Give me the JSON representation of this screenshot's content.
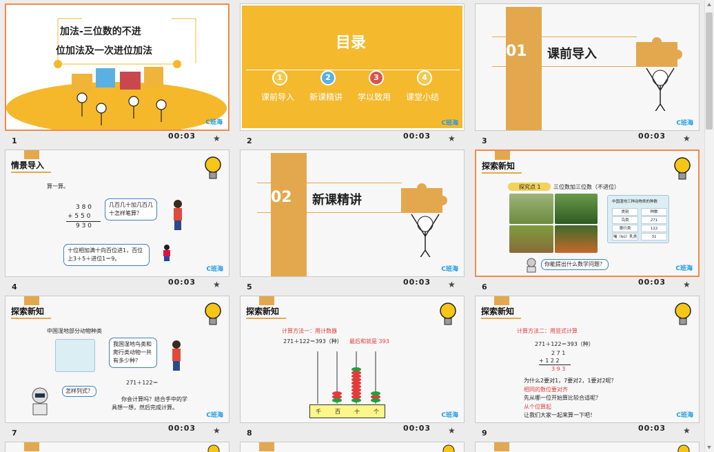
{
  "slides": [
    {
      "num": "1",
      "time": "00:03",
      "logo": "C班海",
      "title_line1": "加法-三位数的不进",
      "title_line2": "位加法及一次进位加法"
    },
    {
      "num": "2",
      "time": "00:03",
      "logo": "C班海",
      "title": "目录",
      "items": [
        {
          "n": "1",
          "label": "课前导入",
          "color": "#f2c94c"
        },
        {
          "n": "2",
          "label": "新课精讲",
          "color": "#5ab0e3"
        },
        {
          "n": "3",
          "label": "学以致用",
          "color": "#d9534f"
        },
        {
          "n": "4",
          "label": "课堂小结",
          "color": "#f2c94c"
        }
      ]
    },
    {
      "num": "3",
      "time": "00:03",
      "logo": "C班海",
      "sec_num": "01",
      "sec_title": "课前导入"
    },
    {
      "num": "4",
      "time": "00:03",
      "logo": "C班海",
      "header": "情景导入",
      "sub": "算一算。",
      "v1": "3 8 0",
      "v2": "+ 5 5 0",
      "v3": "9 3 0",
      "q1": "几百几十加几百几",
      "q2": "十怎样笔算？",
      "a1": "十位相加满十向百位进1，百位",
      "a2": "上3＋5＋进位1＝9。"
    },
    {
      "num": "5",
      "time": "00:03",
      "logo": "C班海",
      "sec_num": "02",
      "sec_title": "新课精讲"
    },
    {
      "num": "6",
      "time": "00:03",
      "logo": "C班海",
      "header": "探索新知",
      "tag": "探究点 1",
      "tag_text": "三位数加三位数（不进位）",
      "table_title": "中国湿地三种动物类的种数",
      "table_head": [
        "类别",
        "种数"
      ],
      "table_rows": [
        [
          "鸟类",
          "271"
        ],
        [
          "爬行类",
          "122"
        ],
        [
          "哺（bǔ）乳类",
          "31"
        ]
      ],
      "question": "你能提出什么数学问题？"
    },
    {
      "num": "7",
      "time": "00:03",
      "logo": "C班海",
      "header": "探索新知",
      "caption": "中国湿地部分动物种类",
      "b1": "我国湿地鸟类和",
      "b2": "爬行类动物一共",
      "b3": "有多少种？",
      "eq": "271＋122＝",
      "b4": "怎样列式？",
      "t1": "你会计算吗？结合手中的学",
      "t2": "具想一想，然后完成计算。"
    },
    {
      "num": "8",
      "time": "00:03",
      "logo": "C班海",
      "header": "探索新知",
      "m1": "计算方法一：用计数器",
      "eq": "271＋122＝393（种）",
      "r": "最后和就是 393",
      "abacus": [
        "千",
        "百",
        "十",
        "个"
      ]
    },
    {
      "num": "9",
      "time": "00:03",
      "logo": "C班海",
      "header": "探索新知",
      "m2": "计算方法二：用竖式计算",
      "eq": "271＋122＝393（种）",
      "c1": "2 7 1",
      "c2": "+   1 2 2",
      "c3": "3 9 3",
      "l1": "为什么2要对1，7要对2，1要对2呢？",
      "l2": "相同的数位要对齐",
      "l3": "先从哪一位开始算比较合适呢？",
      "l4": "从个位算起",
      "l5": "让我们大家一起来算一下吧！"
    }
  ],
  "colors": {
    "accent": "#f08a4b",
    "gold": "#e3a84d",
    "yellow": "#f5b92e",
    "blue": "#1e9be9"
  }
}
